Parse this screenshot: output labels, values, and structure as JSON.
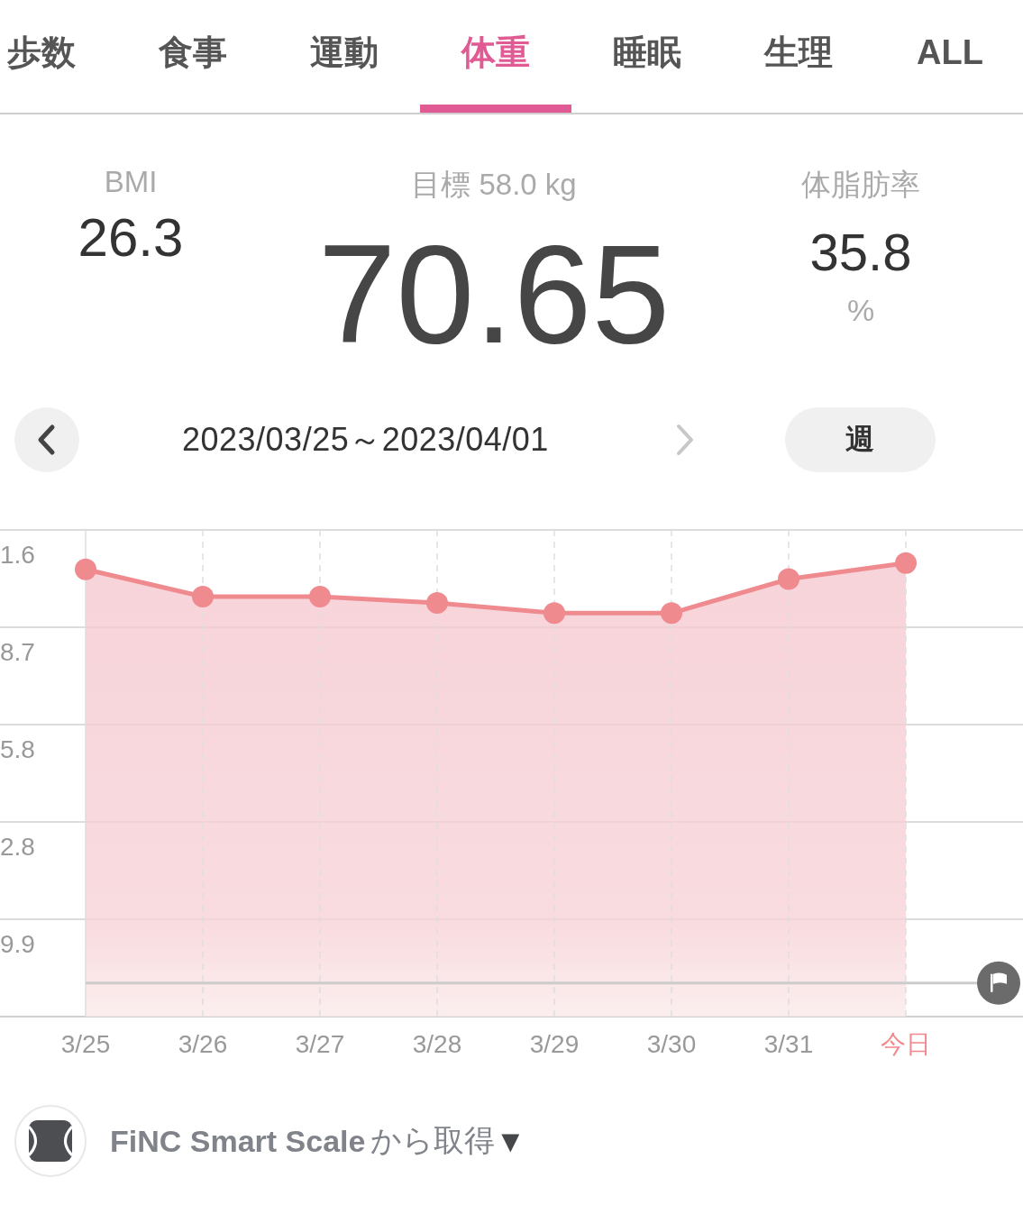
{
  "tabs": [
    {
      "label": "歩数",
      "selected": false
    },
    {
      "label": "食事",
      "selected": false
    },
    {
      "label": "運動",
      "selected": false
    },
    {
      "label": "体重",
      "selected": true
    },
    {
      "label": "睡眠",
      "selected": false
    },
    {
      "label": "生理",
      "selected": false
    },
    {
      "label": "ALL",
      "selected": false
    }
  ],
  "stats": {
    "bmi": {
      "label": "BMI",
      "value": "26.3"
    },
    "goal": "目標 58.0 kg",
    "weight": "70.65",
    "body_fat": {
      "label": "体脂肪率",
      "value": "35.8",
      "unit": "%"
    }
  },
  "period": {
    "range": "2023/03/25～2023/04/01",
    "button": "週"
  },
  "chart": {
    "y_labels": [
      "1.6",
      "8.7",
      "5.8",
      "2.8",
      "9.9"
    ],
    "x_labels": [
      "3/25",
      "3/26",
      "3/27",
      "3/28",
      "3/29",
      "3/30",
      "3/31",
      "今日"
    ]
  },
  "source": {
    "device": "FiNC Smart Scale",
    "suffix": "から取得",
    "caret": "▼"
  }
}
